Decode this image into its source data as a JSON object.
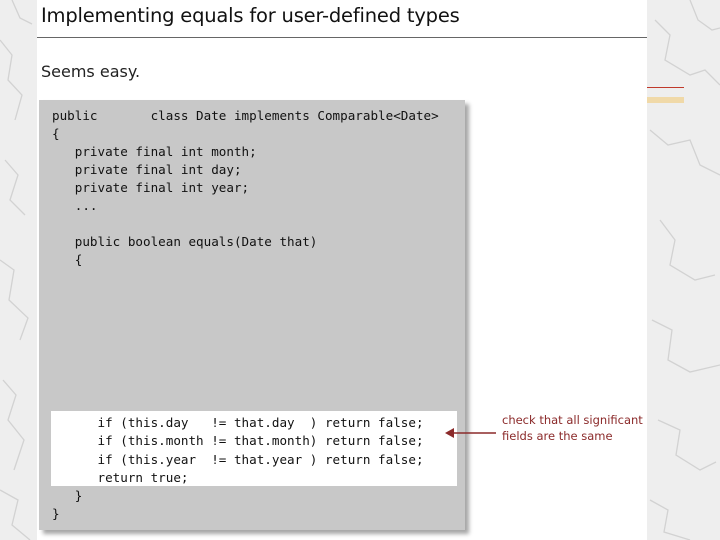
{
  "slide": {
    "title": "Implementing equals for user-defined types",
    "subtitle": "Seems easy."
  },
  "code": {
    "lines": [
      "public       class Date implements Comparable<Date>",
      "{",
      "   private final int month;",
      "   private final int day;",
      "   private final int year;",
      "   ...",
      "",
      "   public boolean equals(Date that)",
      "   {",
      "",
      "",
      "",
      "",
      "",
      "",
      "",
      "",
      "      if (this.day   != that.day  ) return false;",
      "      if (this.month != that.month) return false;",
      "      if (this.year  != that.year ) return false;",
      "      return true;",
      "   }",
      "}"
    ]
  },
  "annotation": {
    "line1": "check that all significant",
    "line2": "fields are the same"
  },
  "colors": {
    "annotation": "#8b2a2a",
    "code_background": "#c8c8c8",
    "highlight": "#ffffff"
  }
}
